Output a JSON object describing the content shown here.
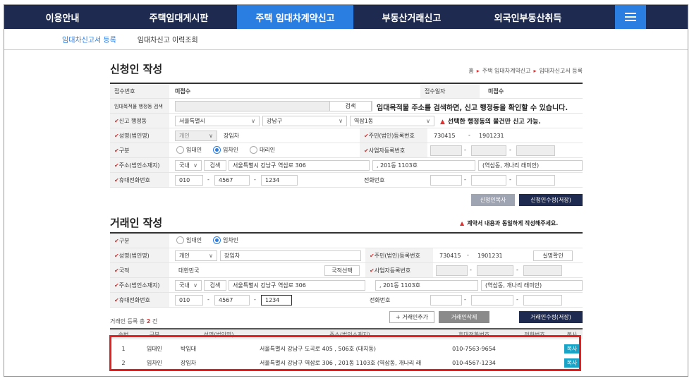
{
  "nav": {
    "items": [
      "이용안내",
      "주택임대게시판",
      "주택 임대차계약신고",
      "부동산거래신고",
      "외국인부동산취득"
    ],
    "active_index": 2
  },
  "subnav": {
    "items": [
      "임대차신고서 등록",
      "임대차신고 이력조회"
    ]
  },
  "applicant": {
    "title": "신청인 작성",
    "breadcrumb": [
      "홈",
      "주택 임대차계약신고",
      "임대차신고서 등록"
    ],
    "receipt_no_label": "접수번호",
    "receipt_no_value": "미접수",
    "receipt_date_label": "접수일자",
    "receipt_date_value": "미접수",
    "address_search_label": "임대목적물 행정동 검색",
    "search_button": "검색",
    "address_search_notice": "임대목적물 주소를 검색하면, 신고 행정동을 확인할 수 있습니다.",
    "admin_label": "신고 행정동",
    "admin_city": "서울특별시",
    "admin_district": "강남구",
    "admin_dong": "역삼1동",
    "admin_warning": "선택한 행정동의 물건만 신고 가능.",
    "name_label": "성명(법인명)",
    "name_type": "개인",
    "name_value": "장임차",
    "resident_label": "주민(법인)등록번호",
    "resident_front": "730415",
    "resident_back": "1901231",
    "type_label": "구분",
    "type_options": [
      "임대인",
      "임차인",
      "대리인"
    ],
    "type_selected": 1,
    "biz_label": "사업자등록번호",
    "addr_label": "주소(법인소재지)",
    "addr_country": "국내",
    "addr_search": "검색",
    "addr_road": "서울특별시 강남구 역삼로 306",
    "addr_detail": ", 201동 1103호",
    "addr_extra": "(역삼동, 개나리 래미안)",
    "mobile_label": "휴대전화번호",
    "mobile": [
      "010",
      "4567",
      "1234"
    ],
    "phone_label": "전화번호",
    "copy_button": "신청인복사",
    "save_button": "신청인수정(저장)"
  },
  "party": {
    "title": "거래인 작성",
    "warning": "계약서 내용과 동일하게 작성해주세요.",
    "type_label": "구분",
    "type_options": [
      "임대인",
      "임차인"
    ],
    "type_selected": 1,
    "name_label": "성명(법인명)",
    "name_type": "개인",
    "name_value": "장임차",
    "resident_label": "주민(법인)등록번호",
    "resident_front": "730415",
    "resident_back": "1901231",
    "verify_button": "실명확인",
    "nation_label": "국적",
    "nation_value": "대한민국",
    "nation_button": "국적선택",
    "biz_label": "사업자등록번호",
    "addr_label": "주소(법인소재지)",
    "addr_country": "국내",
    "addr_search": "검색",
    "addr_road": "서울특별시 강남구 역삼로 306",
    "addr_detail": ", 201동 1103호",
    "addr_extra": "(역삼동, 개나리 래미안)",
    "mobile_label": "휴대전화번호",
    "mobile": [
      "010",
      "4567",
      "1234"
    ],
    "phone_label": "전화번호",
    "count_prefix": "거래인 등록 총",
    "count": "2",
    "count_suffix": "건",
    "add_button": "+ 거래인추가",
    "delete_button": "거래인삭제",
    "save_button": "거래인수정(저장)"
  },
  "table": {
    "headers": [
      "순번",
      "구분",
      "성명(법인명)",
      "주소(법인소재지)",
      "휴대전화번호",
      "전화번호",
      "복사"
    ],
    "rows": [
      {
        "no": "1",
        "type": "임대인",
        "name": "박임대",
        "addr": "서울특별시 강남구 도곡로 405 , 506호  (대치동)",
        "mobile": "010-7563-9654",
        "phone": "",
        "copy": "복사"
      },
      {
        "no": "2",
        "type": "임차인",
        "name": "장임차",
        "addr": "서울특별시 강남구 역삼로 306 , 201동 1103호  (역삼동, 개나리 래",
        "mobile": "010-4567-1234",
        "phone": "",
        "copy": "복사"
      }
    ]
  }
}
